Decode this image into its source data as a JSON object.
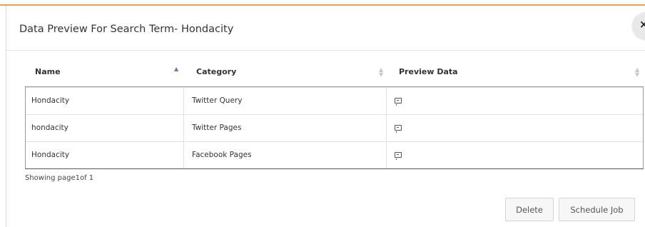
{
  "dialog": {
    "title": "Data Preview For Search Term- Hondacity",
    "close_symbol": "×"
  },
  "table": {
    "columns": [
      {
        "label": "Name",
        "sort": "ascending"
      },
      {
        "label": "Category",
        "sort": "none"
      },
      {
        "label": "Preview Data",
        "sort": "none"
      }
    ],
    "rows": [
      {
        "name": "Hondacity",
        "category": "Twitter Query",
        "preview_icon": "preview-icon"
      },
      {
        "name": "hondacity",
        "category": "Twitter Pages",
        "preview_icon": "preview-icon"
      },
      {
        "name": "Hondacity",
        "category": "Facebook Pages",
        "preview_icon": "preview-icon"
      }
    ]
  },
  "pagination": {
    "text": "Showing page1of 1"
  },
  "footer": {
    "delete_label": "Delete",
    "schedule_label": "Schedule Job"
  },
  "colors": {
    "accent_line": "#f0a045",
    "sort_active": "#6b73c9"
  }
}
